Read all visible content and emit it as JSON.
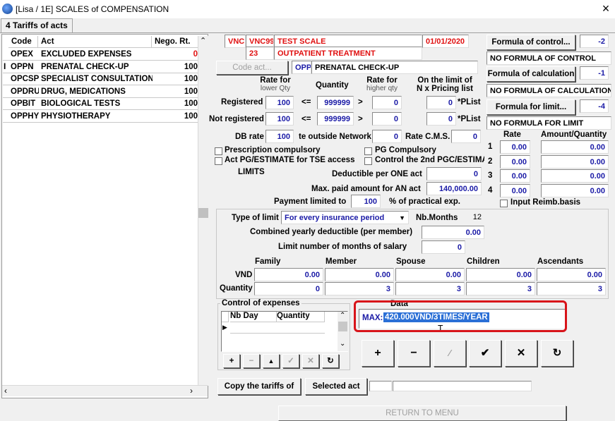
{
  "window": {
    "title": "[Lisa / 1E] SCALES of COMPENSATION",
    "close": "×"
  },
  "tab": {
    "label": "4 Tariffs of acts"
  },
  "acts_list": {
    "headers": {
      "code": "Code",
      "act": "Act",
      "rate": "Nego. Rt."
    },
    "rows": [
      {
        "code": "OPEX",
        "act": "EXCLUDED EXPENSES",
        "rate": "0",
        "rate_color": "#e01010"
      },
      {
        "code": "OPPN",
        "act": "PRENATAL CHECK-UP",
        "rate": "100",
        "rate_color": "#000000"
      },
      {
        "code": "OPCSP",
        "act": "SPECIALIST CONSULTATION",
        "rate": "100",
        "rate_color": "#000000"
      },
      {
        "code": "OPDRU",
        "act": "DRUG, MEDICATIONS",
        "rate": "100",
        "rate_color": "#000000"
      },
      {
        "code": "OPBIT",
        "act": "BIOLOGICAL TESTS",
        "rate": "100",
        "rate_color": "#000000"
      },
      {
        "code": "OPPHY",
        "act": "PHYSIOTHERAPY",
        "rate": "100",
        "rate_color": "#000000"
      }
    ],
    "cursor_marker": "I"
  },
  "scale": {
    "vnc": "VNC",
    "code": "VNC99",
    "name": "TEST SCALE",
    "date": "01/01/2020",
    "sub_code": "23",
    "sub_name": "OUTPATIENT TREATMENT"
  },
  "code_act": {
    "button": "Code act...",
    "code": "OPP",
    "name": "PRENATAL CHECK-UP"
  },
  "rate_table": {
    "rate_for_lower": "Rate for",
    "lower_qty": "lower Qty",
    "quantity": "Quantity",
    "rate_for_higher": "Rate for",
    "higher_qty": "higher qty",
    "limit_title": "On the limit of",
    "limit_sub": "N x Pricing list",
    "registered_label": "Registered",
    "not_registered_label": "Not registered",
    "registered": {
      "rate": "100",
      "op1": "<=",
      "qty": "999999",
      "op2": ">",
      "higher": "0",
      "plist": "0",
      "plist_label": "*PList"
    },
    "not_registered": {
      "rate": "100",
      "op1": "<=",
      "qty": "999999",
      "op2": ">",
      "higher": "0",
      "plist": "0",
      "plist_label": "*PList"
    },
    "db_rate_label": "DB rate",
    "db_rate": "100",
    "outside_label": "te outside Network",
    "outside": "0",
    "cms_label": "Rate C.M.S.",
    "cms": "0"
  },
  "checks": {
    "prescription": "Prescription compulsory",
    "pg": "PG Compulsory",
    "act_pg": "Act PG/ESTIMATE for TSE access",
    "control_2nd": "Control the 2nd PGC/ESTIMA"
  },
  "limits": {
    "title": "LIMITS",
    "deductible_label": "Deductible per ONE act",
    "deductible": "0",
    "max_paid_label": "Max. paid amount for AN act",
    "max_paid": "140,000.00",
    "payment_label": "Payment limited to",
    "payment": "100",
    "payment_suffix": "% of practical exp."
  },
  "formulas": {
    "control_btn": "Formula of control...",
    "control_val": "-2",
    "control_text": "NO FORMULA OF CONTROL",
    "calc_btn": "Formula of calculation",
    "calc_val": "-1",
    "calc_text": "NO FORMULA OF CALCULATION",
    "limit_btn": "Formula for limit...",
    "limit_val": "-4",
    "limit_text": "NO FORMULA FOR LIMIT"
  },
  "reimb": {
    "rate_header": "Rate",
    "amount_header": "Amount/Quantity",
    "rows": [
      {
        "n": "1",
        "rate": "0.00",
        "amount": "0.00"
      },
      {
        "n": "2",
        "rate": "0.00",
        "amount": "0.00"
      },
      {
        "n": "3",
        "rate": "0.00",
        "amount": "0.00"
      },
      {
        "n": "4",
        "rate": "0.00",
        "amount": "0.00"
      }
    ],
    "input_basis": "Input Reimb.basis"
  },
  "limit_type": {
    "type_label": "Type of limit",
    "type_value": "For every insurance period",
    "nb_months_label": "Nb.Months",
    "nb_months": "12",
    "combined_label": "Combined yearly deductible (per member)",
    "combined": "0.00",
    "salary_label": "Limit number of months of salary",
    "salary": "0"
  },
  "amounts": {
    "headers": [
      "Family",
      "Member",
      "Spouse",
      "Children",
      "Ascendants"
    ],
    "vnd_label": "VND",
    "vnd": [
      "0.00",
      "0.00",
      "0.00",
      "0.00",
      "0.00"
    ],
    "qty_label": "Quantity",
    "qty": [
      "0",
      "3",
      "3",
      "3",
      "3"
    ]
  },
  "control_expenses": {
    "title": "Control of expenses",
    "col1": "Nb Day",
    "col2": "Quantity"
  },
  "data_box": {
    "label": "Data",
    "prefix": "MAX:",
    "value": "420.000VND/3TIMES/YEAR"
  },
  "actions": {
    "copy": "Copy the tariffs of",
    "selected": "Selected act",
    "return": "RETURN TO MENU"
  },
  "colors": {
    "highlight": "#d8141a",
    "value_blue": "#1a1aa6",
    "selection": "#2a6fd6"
  }
}
